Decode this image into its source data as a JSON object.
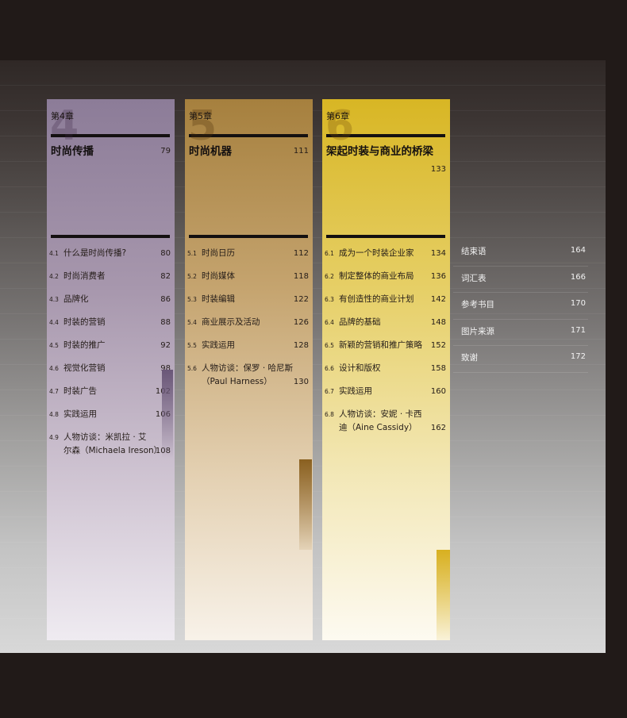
{
  "chapters": [
    {
      "label": "第4章",
      "number": "4",
      "title": "时尚传播",
      "page": "79",
      "sections": [
        {
          "num": "4.1",
          "title": "什么是时尚传播?",
          "page": "80"
        },
        {
          "num": "4.2",
          "title": "时尚消费者",
          "page": "82"
        },
        {
          "num": "4.3",
          "title": "品牌化",
          "page": "86"
        },
        {
          "num": "4.4",
          "title": "时装的营销",
          "page": "88"
        },
        {
          "num": "4.5",
          "title": "时装的推广",
          "page": "92"
        },
        {
          "num": "4.6",
          "title": "视觉化营销",
          "page": "98"
        },
        {
          "num": "4.7",
          "title": "时装广告",
          "page": "102"
        },
        {
          "num": "4.8",
          "title": "实践运用",
          "page": "106"
        },
        {
          "num": "4.9",
          "title": "人物访谈：米凯拉 · 艾",
          "title2": "尔森（Michaela Ireson）",
          "page": "108"
        }
      ]
    },
    {
      "label": "第5章",
      "number": "5",
      "title": "时尚机器",
      "page": "111",
      "sections": [
        {
          "num": "5.1",
          "title": "时尚日历",
          "page": "112"
        },
        {
          "num": "5.2",
          "title": "时尚媒体",
          "page": "118"
        },
        {
          "num": "5.3",
          "title": "时装编辑",
          "page": "122"
        },
        {
          "num": "5.4",
          "title": "商业展示及活动",
          "page": "126"
        },
        {
          "num": "5.5",
          "title": "实践运用",
          "page": "128"
        },
        {
          "num": "5.6",
          "title": "人物访谈：保罗 · 哈尼斯",
          "title2": "（Paul Harness）",
          "page": "130"
        }
      ]
    },
    {
      "label": "第6章",
      "number": "6",
      "title": "架起时装与商业的桥梁",
      "page": "133",
      "sections": [
        {
          "num": "6.1",
          "title": "成为一个时装企业家",
          "page": "134"
        },
        {
          "num": "6.2",
          "title": "制定整体的商业布局",
          "page": "136"
        },
        {
          "num": "6.3",
          "title": "有创造性的商业计划",
          "page": "142"
        },
        {
          "num": "6.4",
          "title": "品牌的基础",
          "page": "148"
        },
        {
          "num": "6.5",
          "title": "新颖的营销和推广策略",
          "page": "152"
        },
        {
          "num": "6.6",
          "title": "设计和版权",
          "page": "158"
        },
        {
          "num": "6.7",
          "title": "实践运用",
          "page": "160"
        },
        {
          "num": "6.8",
          "title": "人物访谈：安妮 · 卡西",
          "title2": "迪（Aine Cassidy）",
          "page": "162"
        }
      ]
    }
  ],
  "endmatter": [
    {
      "title": "结束语",
      "page": "164"
    },
    {
      "title": "词汇表",
      "page": "166"
    },
    {
      "title": "参考书目",
      "page": "170"
    },
    {
      "title": "图片来源",
      "page": "171"
    },
    {
      "title": "致谢",
      "page": "172"
    }
  ]
}
